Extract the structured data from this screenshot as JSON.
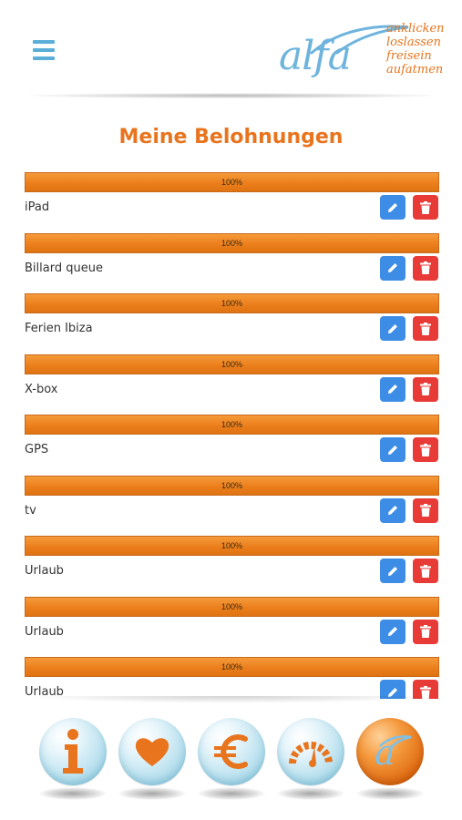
{
  "header": {
    "menu_icon": "hamburger-menu-icon",
    "logo": {
      "word": "alfa",
      "tagline": [
        "anklicken",
        "loslassen",
        "freisein",
        "aufatmen"
      ]
    }
  },
  "page": {
    "title": "Meine Belohnungen"
  },
  "rewards": [
    {
      "label": "iPad",
      "progress": 100,
      "progress_text": "100%"
    },
    {
      "label": "Billard queue",
      "progress": 100,
      "progress_text": "100%"
    },
    {
      "label": "Ferien Ibiza",
      "progress": 100,
      "progress_text": "100%"
    },
    {
      "label": "X-box",
      "progress": 100,
      "progress_text": "100%"
    },
    {
      "label": "GPS",
      "progress": 100,
      "progress_text": "100%"
    },
    {
      "label": "tv",
      "progress": 100,
      "progress_text": "100%"
    },
    {
      "label": "Urlaub",
      "progress": 100,
      "progress_text": "100%"
    },
    {
      "label": "Urlaub",
      "progress": 100,
      "progress_text": "100%"
    },
    {
      "label": "Urlaub",
      "progress": 100,
      "progress_text": "100%"
    }
  ],
  "actions": {
    "edit_icon": "pencil-icon",
    "delete_icon": "trash-icon"
  },
  "bottom_nav": [
    {
      "name": "info",
      "icon": "info-icon",
      "active": false
    },
    {
      "name": "favorites",
      "icon": "heart-icon",
      "active": false
    },
    {
      "name": "money",
      "icon": "euro-icon",
      "active": false
    },
    {
      "name": "dashboard",
      "icon": "gauge-icon",
      "active": false
    },
    {
      "name": "home",
      "icon": "alfa-logo-icon",
      "active": true
    }
  ],
  "colors": {
    "accent_orange": "#e8741e",
    "brand_blue": "#6eb4dd",
    "edit_blue": "#3d8de6",
    "delete_red": "#e83a36"
  }
}
